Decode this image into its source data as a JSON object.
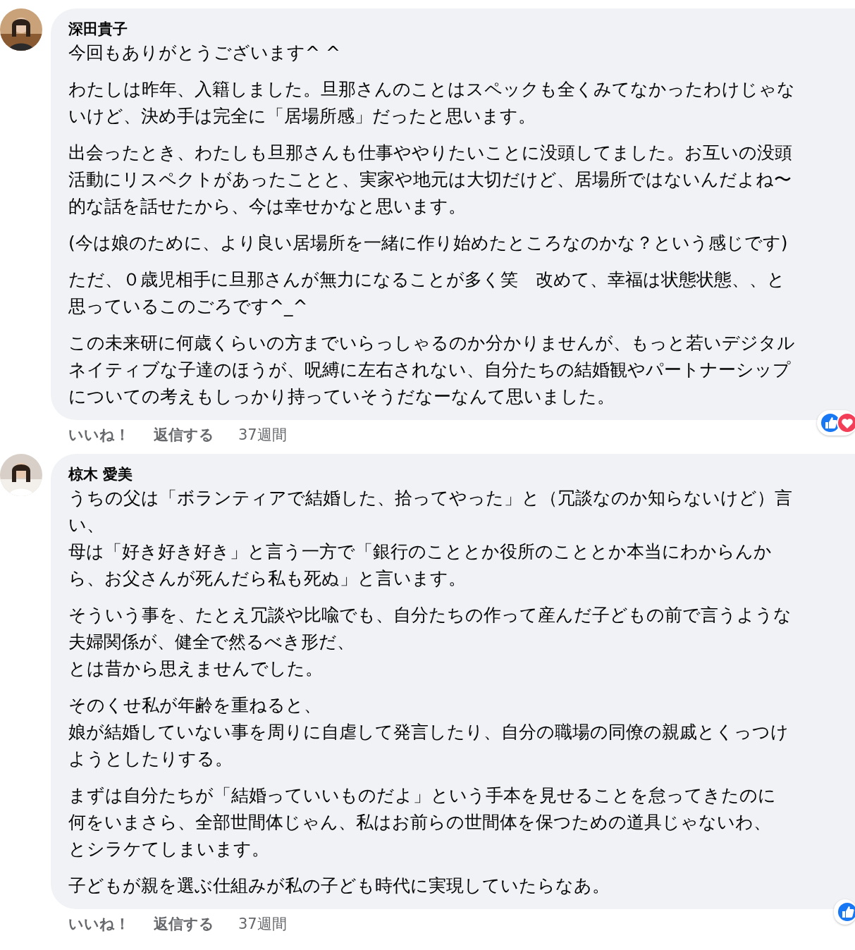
{
  "comments": [
    {
      "author": "深田貴子",
      "reactions": [
        {
          "kind": "like"
        },
        {
          "kind": "love"
        }
      ],
      "paragraphs": [
        [
          "今回もありがとうございます^ ^"
        ],
        [
          "わたしは昨年、入籍しました。旦那さんのことはスペックも全くみてなかったわけじゃな",
          "いけど、決め手は完全に「居場所感」だったと思います。"
        ],
        [
          "出会ったとき、わたしも旦那さんも仕事ややりたいことに没頭してました。お互いの没頭",
          "活動にリスペクトがあったことと、実家や地元は大切だけど、居場所ではないんだよね〜",
          "的な話を話せたから、今は幸せかなと思います。"
        ],
        [
          "(今は娘のために、より良い居場所を一緒に作り始めたところなのかな？という感じです)"
        ],
        [
          "ただ、０歳児相手に旦那さんが無力になることが多く笑　改めて、幸福は状態状態、、と",
          "思っているこのごろです^_^"
        ],
        [
          "この未来研に何歳くらいの方までいらっしゃるのか分かりませんが、もっと若いデジタル",
          "ネイティブな子達のほうが、呪縛に左右されない、自分たちの結婚観やパートナーシップ",
          "についての考えもしっかり持っていそうだなーなんて思いました。"
        ]
      ],
      "actions": [
        "いいね！",
        "返信する"
      ],
      "time": "37週間"
    },
    {
      "author": "椋木 愛美",
      "reactions": [
        {
          "kind": "like"
        }
      ],
      "paragraphs": [
        [
          "うちの父は「ボランティアで結婚した、拾ってやった」と（冗談なのか知らないけど）言",
          "い、",
          "母は「好き好き好き」と言う一方で「銀行のこととか役所のこととか本当にわからんか",
          "ら、お父さんが死んだら私も死ぬ」と言います。"
        ],
        [
          "そういう事を、たとえ冗談や比喩でも、自分たちの作って産んだ子どもの前で言うような",
          "夫婦関係が、健全で然るべき形だ、",
          "とは昔から思えませんでした。"
        ],
        [
          "そのくせ私が年齢を重ねると、",
          "娘が結婚していない事を周りに自虐して発言したり、自分の職場の同僚の親戚とくっつけ",
          "ようとしたりする。"
        ],
        [
          "まずは自分たちが「結婚っていいものだよ」という手本を見せることを怠ってきたのに",
          "何をいまさら、全部世間体じゃん、私はお前らの世間体を保つための道具じゃないわ、",
          "とシラケてしまいます。"
        ],
        [
          "子どもが親を選ぶ仕組みが私の子ども時代に実現していたらなあ。"
        ]
      ],
      "actions": [
        "いいね！",
        "返信する"
      ],
      "time": "37週間"
    }
  ]
}
